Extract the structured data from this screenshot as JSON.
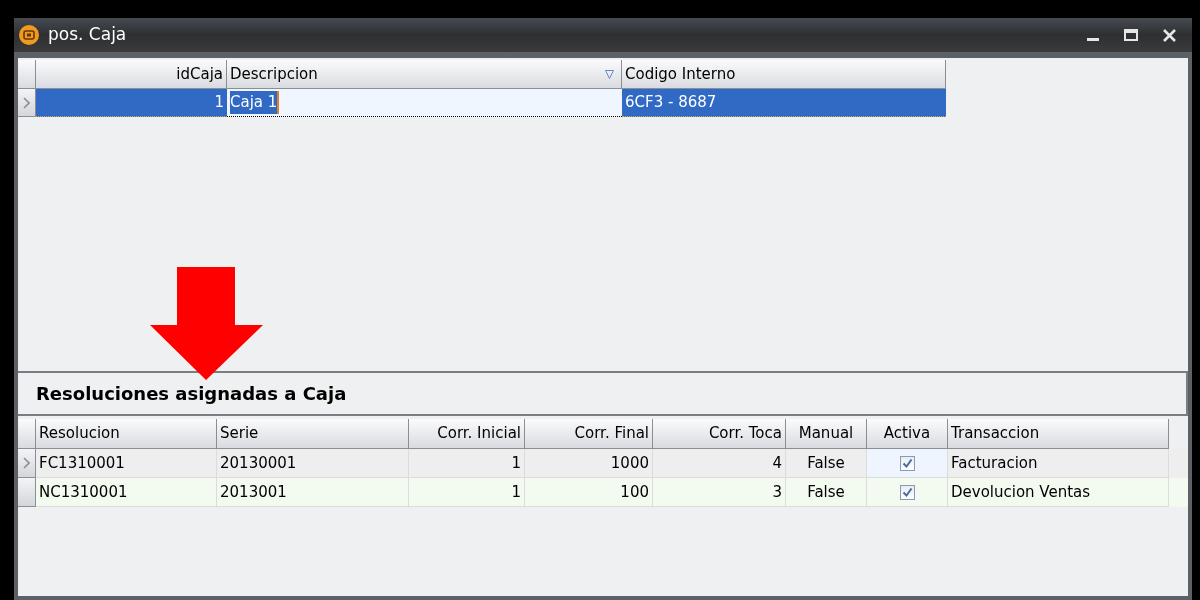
{
  "window": {
    "title": "pos. Caja"
  },
  "cajas": {
    "columns": [
      {
        "label": "idCaja",
        "kind": "number"
      },
      {
        "label": "Descripcion",
        "kind": "text",
        "filtered": true
      },
      {
        "label": "Codigo Interno",
        "kind": "text"
      }
    ],
    "rows": [
      {
        "selected": true,
        "cells": [
          {
            "text": "1"
          },
          {
            "text": "Caja 1",
            "editing": true
          },
          {
            "text": "6CF3 - 8687"
          }
        ]
      }
    ]
  },
  "annotation": {
    "kind": "down-arrow"
  },
  "resoluciones": {
    "title": "Resoluciones asignadas a Caja",
    "columns": [
      {
        "label": "Resolucion",
        "kind": "text"
      },
      {
        "label": "Serie",
        "kind": "text"
      },
      {
        "label": "Corr. Inicial",
        "kind": "number"
      },
      {
        "label": "Corr. Final",
        "kind": "number"
      },
      {
        "label": "Corr. Toca",
        "kind": "number"
      },
      {
        "label": "Manual",
        "kind": "center"
      },
      {
        "label": "Activa",
        "kind": "check"
      },
      {
        "label": "Transaccion",
        "kind": "text"
      }
    ],
    "rows": [
      {
        "current": true,
        "cells": [
          {
            "text": "FC1310001"
          },
          {
            "text": "20130001"
          },
          {
            "text": "1"
          },
          {
            "text": "1000"
          },
          {
            "text": "4"
          },
          {
            "text": "False"
          },
          {
            "checked": true
          },
          {
            "text": "Facturacion"
          }
        ]
      },
      {
        "current": false,
        "cells": [
          {
            "text": "NC1310001"
          },
          {
            "text": "2013001"
          },
          {
            "text": "1"
          },
          {
            "text": "100"
          },
          {
            "text": "3"
          },
          {
            "text": "False"
          },
          {
            "checked": true
          },
          {
            "text": "Devolucion Ventas"
          }
        ]
      }
    ]
  }
}
